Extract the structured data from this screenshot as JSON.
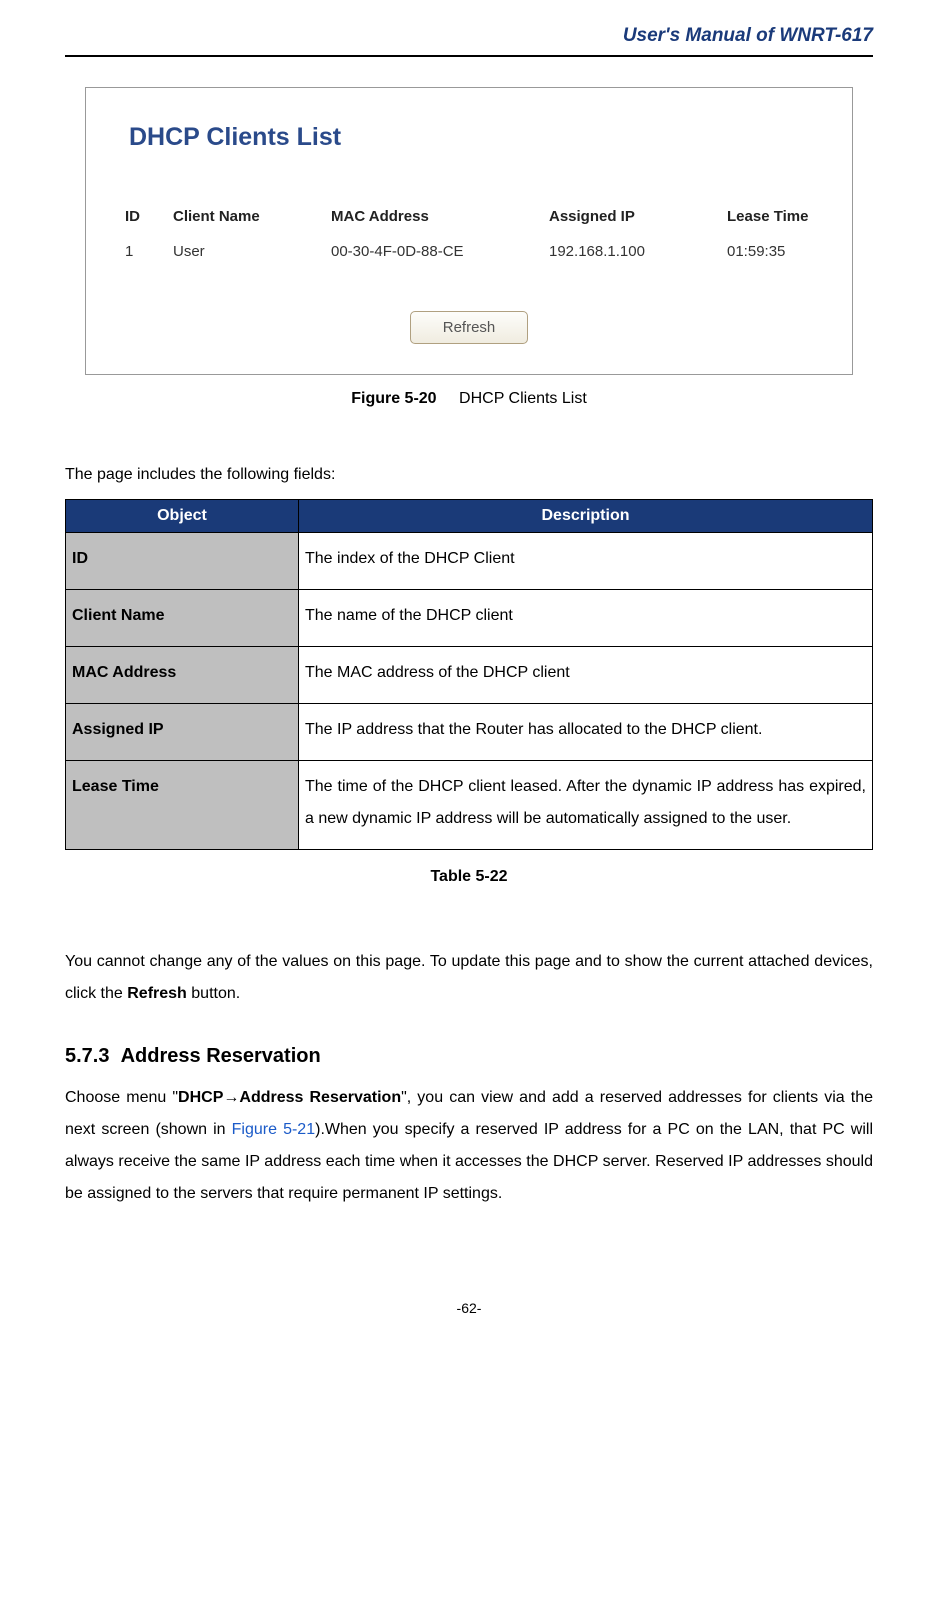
{
  "header": {
    "title": "User's Manual of WNRT-617"
  },
  "screenshot": {
    "panel_title": "DHCP Clients List",
    "columns": {
      "id": "ID",
      "client_name": "Client Name",
      "mac": "MAC Address",
      "assigned_ip": "Assigned IP",
      "lease_time": "Lease Time"
    },
    "row": {
      "id": "1",
      "client_name": "User",
      "mac": "00-30-4F-0D-88-CE",
      "assigned_ip": "192.168.1.100",
      "lease_time": "01:59:35"
    },
    "refresh_label": "Refresh"
  },
  "figure_caption": {
    "label": "Figure 5-20",
    "text": "DHCP Clients List"
  },
  "intro_text": "The page includes the following fields:",
  "desc_table": {
    "head_object": "Object",
    "head_description": "Description",
    "rows": [
      {
        "object": "ID",
        "description": "The index of the DHCP Client"
      },
      {
        "object": "Client Name",
        "description": "The name of the DHCP client"
      },
      {
        "object": "MAC Address",
        "description": "The MAC address of the DHCP client"
      },
      {
        "object": "Assigned IP",
        "description": "The IP address that the Router has allocated to the DHCP client."
      },
      {
        "object": "Lease Time",
        "description": "The time of the DHCP client leased. After the dynamic IP address has expired, a new dynamic IP address will be automatically assigned to the user."
      }
    ]
  },
  "table_caption": "Table 5-22",
  "para1": {
    "pre": "You cannot change any of the values on this page. To update this page and to show the current attached devices, click the ",
    "bold": "Refresh",
    "post": " button."
  },
  "section": {
    "number": "5.7.3",
    "title": "Address Reservation"
  },
  "para2": {
    "t1": "Choose menu \"",
    "b1": "DHCP→Address Reservation",
    "t2": "\", you can view and add a reserved addresses for clients via the next screen (shown in ",
    "link": "Figure 5-21",
    "t3": ").When you specify a reserved IP address for a PC on the LAN, that PC will always receive the same IP address each time when it accesses the DHCP server. Reserved IP addresses should be assigned to the servers that require permanent IP settings."
  },
  "page_number": "-62-"
}
